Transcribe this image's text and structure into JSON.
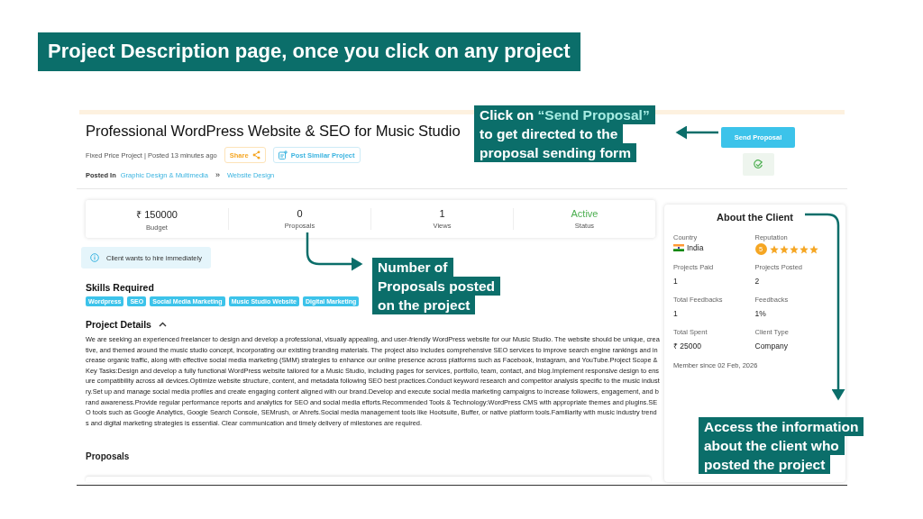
{
  "banner": "Project Description page, once you click on any project",
  "project": {
    "title": "Professional WordPress Website & SEO for Music Studio",
    "meta": "Fixed Price Project | Posted 13 minutes ago",
    "share": "Share",
    "post_similar": "Post Similar Project",
    "posted_in_label": "Posted In",
    "categories": [
      "Graphic Design & Multimedia",
      "Website Design"
    ],
    "separator": "»"
  },
  "actions": {
    "send_proposal": "Send Proposal"
  },
  "stats": [
    {
      "value": "₹ 150000",
      "label": "Budget",
      "kind": "number"
    },
    {
      "value": "0",
      "label": "Proposals",
      "kind": "number"
    },
    {
      "value": "1",
      "label": "Views",
      "kind": "number"
    },
    {
      "value": "Active",
      "label": "Status",
      "kind": "status"
    }
  ],
  "notice": "Client wants to hire immediately",
  "skills": {
    "title": "Skills Required",
    "tags": [
      "Wordpress",
      "SEO",
      "Social Media Marketing",
      "Music Studio Website",
      "Digital Marketing"
    ]
  },
  "details": {
    "title": "Project Details",
    "expanded": true,
    "text": "We are seeking an experienced freelancer to design and develop a professional, visually appealing, and user-friendly WordPress website for our Music Studio. The website should be unique, creative, and themed around the music studio concept, incorporating our existing branding materials. The project also includes comprehensive SEO services to improve search engine rankings and increase organic traffic, along with effective social media marketing (SMM) strategies to enhance our online presence across platforms such as Facebook, Instagram, and YouTube.Project Scope & Key Tasks:Design and develop a fully functional WordPress website tailored for a Music Studio, including pages for services, portfolio, team, contact, and blog.Implement responsive design to ensure compatibility across all devices.Optimize website structure, content, and metadata following SEO best practices.Conduct keyword research and competitor analysis specific to the music industry.Set up and manage social media profiles and create engaging content aligned with our brand.Develop and execute social media marketing campaigns to increase followers, engagement, and brand awareness.Provide regular performance reports and analytics for SEO and social media efforts.Recommended Tools & Technology:WordPress CMS with appropriate themes and plugins.SEO tools such as Google Analytics, Google Search Console, SEMrush, or Ahrefs.Social media management tools like Hootsuite, Buffer, or native platform tools.Familiarity with music industry trends and digital marketing strategies is essential. Clear communication and timely delivery of milestones are required."
  },
  "proposals": {
    "title": "Proposals"
  },
  "client": {
    "title": "About the Client",
    "fields": [
      {
        "label": "Country",
        "value": "India",
        "kind": "country"
      },
      {
        "label": "Reputation",
        "value": "5",
        "kind": "rating",
        "stars": 5
      },
      {
        "label": "Projects Paid",
        "value": "1",
        "kind": "text"
      },
      {
        "label": "Projects Posted",
        "value": "2",
        "kind": "text"
      },
      {
        "label": "Total Feedbacks",
        "value": "1",
        "kind": "text"
      },
      {
        "label": "Feedbacks",
        "value": "1%",
        "kind": "text"
      },
      {
        "label": "Total Spent",
        "value": "₹ 25000",
        "kind": "text"
      },
      {
        "label": "Client Type",
        "value": "Company",
        "kind": "text"
      }
    ],
    "member_since": "Member since 02 Feb, 2026"
  },
  "callouts": [
    {
      "parts": [
        {
          "text": "Click on ",
          "highlight": false
        },
        {
          "text": "“Send Proposal”",
          "highlight": true
        },
        {
          "text": " to get directed to the proposal sending form",
          "highlight": false
        }
      ]
    },
    {
      "parts": [
        {
          "text": "Number of Proposals posted on the project",
          "highlight": false
        }
      ]
    },
    {
      "parts": [
        {
          "text": "Access the information about the client who posted the project",
          "highlight": false
        }
      ]
    }
  ]
}
